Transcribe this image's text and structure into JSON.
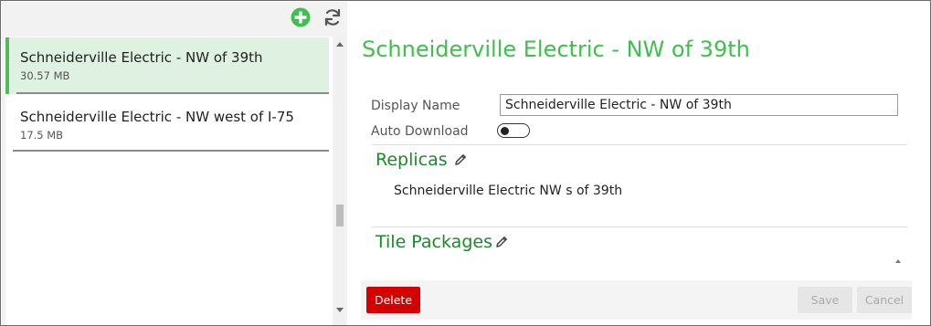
{
  "toolbar": {
    "add_icon": "plus-circle-icon",
    "refresh_icon": "refresh-icon",
    "accent_color": "#3fbf4f"
  },
  "list": {
    "items": [
      {
        "title": "Schneiderville Electric - NW of 39th",
        "size": "30.57 MB",
        "selected": true
      },
      {
        "title": "Schneiderville Electric - NW west of I-75",
        "size": "17.5 MB",
        "selected": false
      }
    ],
    "selected_color": "#dff2e1"
  },
  "detail": {
    "title": "Schneiderville Electric - NW of 39th",
    "display_name_label": "Display Name",
    "display_name_value": "Schneiderville Electric - NW of 39th",
    "auto_download_label": "Auto Download",
    "auto_download_on": false,
    "replicas_heading": "Replicas",
    "replicas": [
      "Schneiderville Electric NW s of 39th"
    ],
    "tile_packages_heading": "Tile Packages",
    "edit_icon": "pencil-icon"
  },
  "footer": {
    "delete_label": "Delete",
    "save_label": "Save",
    "cancel_label": "Cancel",
    "delete_color": "#d40000"
  }
}
